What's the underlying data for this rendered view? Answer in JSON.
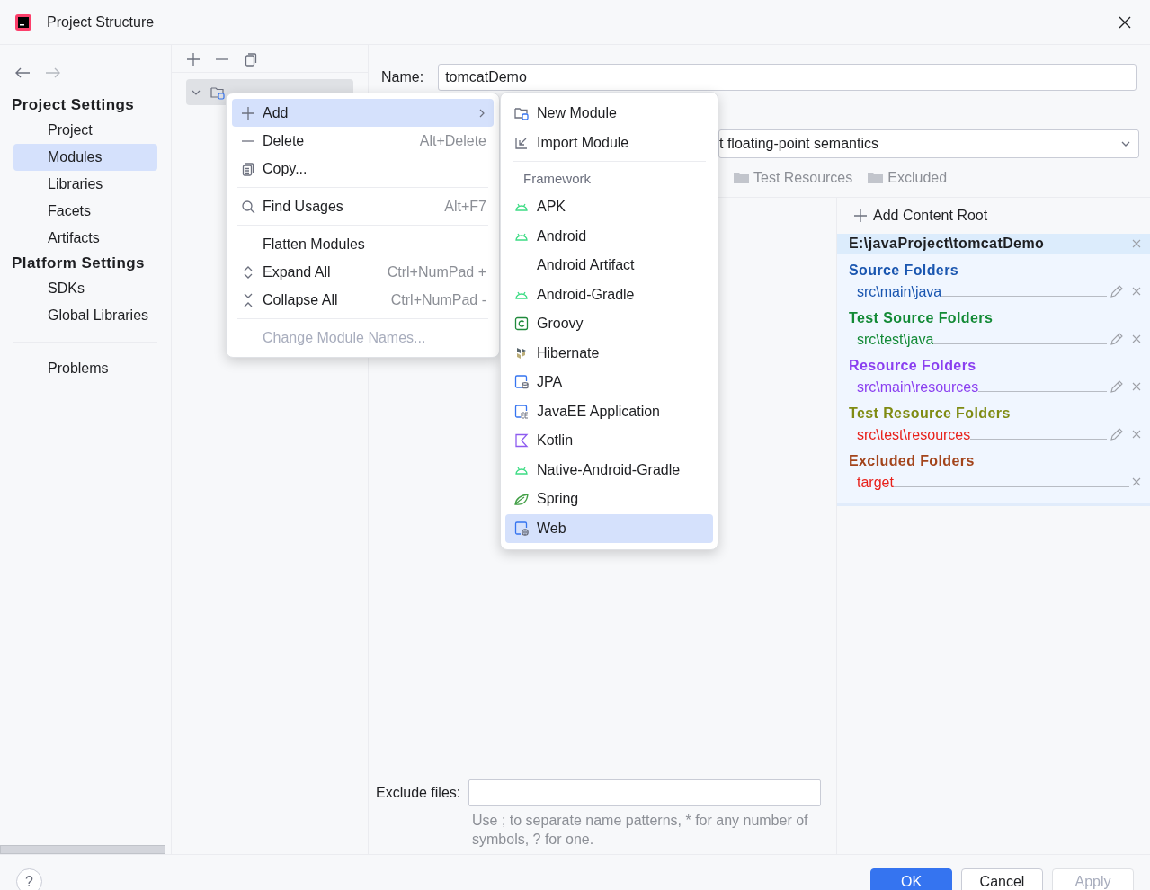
{
  "window": {
    "title": "Project Structure"
  },
  "sidebar": {
    "sections": [
      {
        "heading": "Project Settings",
        "items": [
          {
            "label": "Project",
            "selected": false
          },
          {
            "label": "Modules",
            "selected": true
          },
          {
            "label": "Libraries",
            "selected": false
          },
          {
            "label": "Facets",
            "selected": false
          },
          {
            "label": "Artifacts",
            "selected": false
          }
        ]
      },
      {
        "heading": "Platform Settings",
        "items": [
          {
            "label": "SDKs",
            "selected": false
          },
          {
            "label": "Global Libraries",
            "selected": false
          }
        ]
      }
    ],
    "bottom_items": [
      {
        "label": "Problems",
        "selected": false
      }
    ]
  },
  "tree": {
    "items": [
      {
        "expanded": true,
        "selected": true
      }
    ]
  },
  "context_menu": {
    "items": [
      {
        "kind": "item",
        "label": "Add",
        "selected": true,
        "submenu": true
      },
      {
        "kind": "item",
        "label": "Delete",
        "shortcut": "Alt+Delete",
        "selected": false
      },
      {
        "kind": "item",
        "label": "Copy...",
        "selected": false
      },
      {
        "kind": "separator"
      },
      {
        "kind": "item",
        "label": "Find Usages",
        "shortcut": "Alt+F7",
        "selected": false
      },
      {
        "kind": "separator"
      },
      {
        "kind": "item",
        "label": "Flatten Modules",
        "selected": false
      },
      {
        "kind": "item",
        "label": "Expand All",
        "shortcut": "Ctrl+NumPad +",
        "selected": false
      },
      {
        "kind": "item",
        "label": "Collapse All",
        "shortcut": "Ctrl+NumPad -",
        "selected": false
      },
      {
        "kind": "separator"
      },
      {
        "kind": "item",
        "label": "Change Module Names...",
        "disabled": true,
        "selected": false
      }
    ]
  },
  "submenu": {
    "items": [
      {
        "kind": "item",
        "label": "New Module",
        "selected": false
      },
      {
        "kind": "item",
        "label": "Import Module",
        "selected": false
      },
      {
        "kind": "separator"
      },
      {
        "kind": "header",
        "label": "Framework"
      },
      {
        "kind": "item",
        "label": "APK",
        "selected": false
      },
      {
        "kind": "item",
        "label": "Android",
        "selected": false
      },
      {
        "kind": "item",
        "label": "Android Artifact",
        "selected": false
      },
      {
        "kind": "item",
        "label": "Android-Gradle",
        "selected": false
      },
      {
        "kind": "item",
        "label": "Groovy",
        "selected": false
      },
      {
        "kind": "item",
        "label": "Hibernate",
        "selected": false
      },
      {
        "kind": "item",
        "label": "JPA",
        "selected": false
      },
      {
        "kind": "item",
        "label": "JavaEE Application",
        "selected": false
      },
      {
        "kind": "item",
        "label": "Kotlin",
        "selected": false
      },
      {
        "kind": "item",
        "label": "Native-Android-Gradle",
        "selected": false
      },
      {
        "kind": "item",
        "label": "Spring",
        "selected": false
      },
      {
        "kind": "item",
        "label": "Web",
        "selected": true
      }
    ]
  },
  "name_field": {
    "label": "Name:",
    "value": "tomcatDemo"
  },
  "language_level": {
    "value": "t floating-point semantics"
  },
  "mark_as": [
    "Test Resources",
    "Excluded"
  ],
  "content_root": {
    "add_label": "Add Content Root",
    "path": "E:\\javaProject\\tomcatDemo",
    "groups": [
      {
        "title": "Source Folders",
        "color": "#1a56b0",
        "folders": [
          {
            "path": "src\\main\\java",
            "color": "#1a56b0",
            "editable": true
          }
        ]
      },
      {
        "title": "Test Source Folders",
        "color": "#138a36",
        "folders": [
          {
            "path": "src\\test\\java",
            "color": "#138a36",
            "editable": true
          }
        ]
      },
      {
        "title": "Resource Folders",
        "color": "#8a3ff0",
        "folders": [
          {
            "path": "src\\main\\resources",
            "color": "#8a3ff0",
            "editable": true
          }
        ]
      },
      {
        "title": "Test Resource Folders",
        "color": "#7f8b12",
        "folders": [
          {
            "path": "src\\test\\resources",
            "color": "#e8201a",
            "editable": true
          }
        ]
      },
      {
        "title": "Excluded Folders",
        "color": "#a3441b",
        "folders": [
          {
            "path": "target",
            "color": "#e8201a",
            "editable": false
          }
        ]
      }
    ]
  },
  "exclude_files": {
    "label": "Exclude files:",
    "hint": "Use ; to separate name patterns, * for any number of symbols, ? for one."
  },
  "buttons": [
    {
      "label": "OK",
      "kind": "primary",
      "disabled": false
    },
    {
      "label": "Cancel",
      "kind": "normal",
      "disabled": false
    },
    {
      "label": "Apply",
      "kind": "normal",
      "disabled": true
    }
  ],
  "help": "?"
}
